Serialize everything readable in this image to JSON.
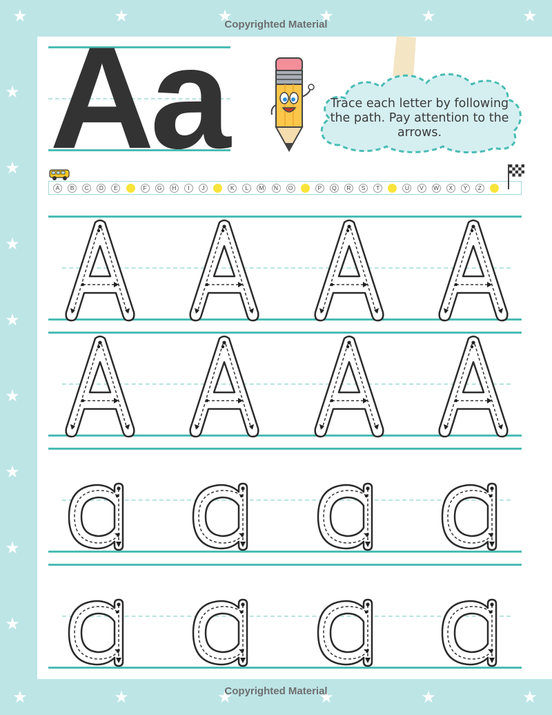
{
  "page": {
    "copyright_top": "Copyrighted Material",
    "copyright_bottom": "Copyrighted Material"
  },
  "header": {
    "big_letters": "Aa",
    "instructions": "Trace each letter by following the path. Pay attention to the arrows."
  },
  "alphabet": {
    "letters": [
      "A",
      "B",
      "C",
      "D",
      "E",
      "F",
      "G",
      "H",
      "I",
      "J",
      "K",
      "L",
      "M",
      "N",
      "O",
      "P",
      "Q",
      "R",
      "S",
      "T",
      "U",
      "V",
      "W",
      "X",
      "Y",
      "Z"
    ]
  },
  "colors": {
    "border": "#bde5e6",
    "guide_line": "#4bbcb4",
    "dash_line": "#b9e4e1",
    "dot_yellow": "#f9e43b",
    "letter_dark": "#333333"
  },
  "practice_rows": [
    {
      "letter": "A",
      "count": 4
    },
    {
      "letter": "A",
      "count": 4
    },
    {
      "letter": "a",
      "count": 4
    },
    {
      "letter": "a",
      "count": 4
    }
  ],
  "icons": [
    "star-icon",
    "pencil-mascot-icon",
    "cloud-bubble-icon",
    "school-bus-icon",
    "checkered-flag-icon",
    "tape-icon"
  ]
}
